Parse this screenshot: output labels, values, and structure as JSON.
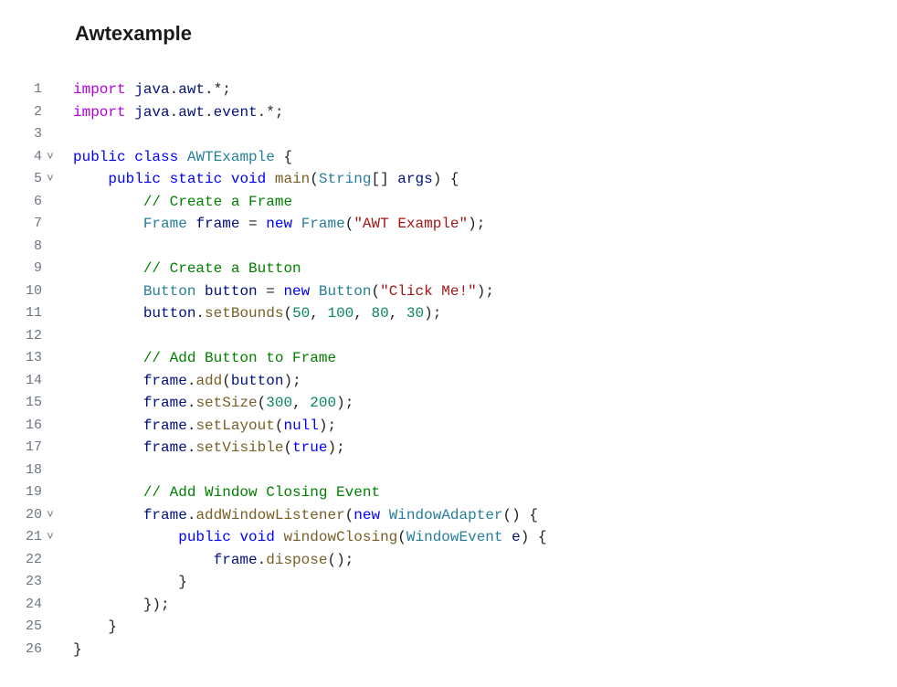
{
  "header": {
    "title": "Awtexample"
  },
  "gutter": {
    "chevron": "˅"
  },
  "lines": [
    {
      "n": 1,
      "fold": "",
      "segs": [
        [
          "kw2",
          "import"
        ],
        [
          "punc",
          " "
        ],
        [
          "id",
          "java"
        ],
        [
          "punc",
          "."
        ],
        [
          "id",
          "awt"
        ],
        [
          "punc",
          ".*;"
        ]
      ]
    },
    {
      "n": 2,
      "fold": "",
      "segs": [
        [
          "kw2",
          "import"
        ],
        [
          "punc",
          " "
        ],
        [
          "id",
          "java"
        ],
        [
          "punc",
          "."
        ],
        [
          "id",
          "awt"
        ],
        [
          "punc",
          "."
        ],
        [
          "id",
          "event"
        ],
        [
          "punc",
          ".*;"
        ]
      ]
    },
    {
      "n": 3,
      "fold": "",
      "segs": []
    },
    {
      "n": 4,
      "fold": "v",
      "segs": [
        [
          "kw",
          "public"
        ],
        [
          "punc",
          " "
        ],
        [
          "kw",
          "class"
        ],
        [
          "punc",
          " "
        ],
        [
          "cls",
          "AWTExample"
        ],
        [
          "punc",
          " {"
        ]
      ]
    },
    {
      "n": 5,
      "fold": "v",
      "segs": [
        [
          "punc",
          "    "
        ],
        [
          "kw",
          "public"
        ],
        [
          "punc",
          " "
        ],
        [
          "kw",
          "static"
        ],
        [
          "punc",
          " "
        ],
        [
          "kw",
          "void"
        ],
        [
          "punc",
          " "
        ],
        [
          "fn",
          "main"
        ],
        [
          "punc",
          "("
        ],
        [
          "cls",
          "String"
        ],
        [
          "punc",
          "[] "
        ],
        [
          "id",
          "args"
        ],
        [
          "punc",
          ") {"
        ]
      ]
    },
    {
      "n": 6,
      "fold": "",
      "segs": [
        [
          "punc",
          "        "
        ],
        [
          "cmt",
          "// Create a Frame"
        ]
      ]
    },
    {
      "n": 7,
      "fold": "",
      "segs": [
        [
          "punc",
          "        "
        ],
        [
          "cls",
          "Frame"
        ],
        [
          "punc",
          " "
        ],
        [
          "id",
          "frame"
        ],
        [
          "punc",
          " = "
        ],
        [
          "kw",
          "new"
        ],
        [
          "punc",
          " "
        ],
        [
          "cls",
          "Frame"
        ],
        [
          "punc",
          "("
        ],
        [
          "str",
          "\"AWT Example\""
        ],
        [
          "punc",
          ");"
        ]
      ]
    },
    {
      "n": 8,
      "fold": "",
      "segs": []
    },
    {
      "n": 9,
      "fold": "",
      "segs": [
        [
          "punc",
          "        "
        ],
        [
          "cmt",
          "// Create a Button"
        ]
      ]
    },
    {
      "n": 10,
      "fold": "",
      "segs": [
        [
          "punc",
          "        "
        ],
        [
          "cls",
          "Button"
        ],
        [
          "punc",
          " "
        ],
        [
          "id",
          "button"
        ],
        [
          "punc",
          " = "
        ],
        [
          "kw",
          "new"
        ],
        [
          "punc",
          " "
        ],
        [
          "cls",
          "Button"
        ],
        [
          "punc",
          "("
        ],
        [
          "str",
          "\"Click Me!\""
        ],
        [
          "punc",
          ");"
        ]
      ]
    },
    {
      "n": 11,
      "fold": "",
      "segs": [
        [
          "punc",
          "        "
        ],
        [
          "id",
          "button"
        ],
        [
          "punc",
          "."
        ],
        [
          "fn",
          "setBounds"
        ],
        [
          "punc",
          "("
        ],
        [
          "num",
          "50"
        ],
        [
          "punc",
          ", "
        ],
        [
          "num",
          "100"
        ],
        [
          "punc",
          ", "
        ],
        [
          "num",
          "80"
        ],
        [
          "punc",
          ", "
        ],
        [
          "num",
          "30"
        ],
        [
          "punc",
          ");"
        ]
      ]
    },
    {
      "n": 12,
      "fold": "",
      "segs": []
    },
    {
      "n": 13,
      "fold": "",
      "segs": [
        [
          "punc",
          "        "
        ],
        [
          "cmt",
          "// Add Button to Frame"
        ]
      ]
    },
    {
      "n": 14,
      "fold": "",
      "segs": [
        [
          "punc",
          "        "
        ],
        [
          "id",
          "frame"
        ],
        [
          "punc",
          "."
        ],
        [
          "fn",
          "add"
        ],
        [
          "punc",
          "("
        ],
        [
          "id",
          "button"
        ],
        [
          "punc",
          ");"
        ]
      ]
    },
    {
      "n": 15,
      "fold": "",
      "segs": [
        [
          "punc",
          "        "
        ],
        [
          "id",
          "frame"
        ],
        [
          "punc",
          "."
        ],
        [
          "fn",
          "setSize"
        ],
        [
          "punc",
          "("
        ],
        [
          "num",
          "300"
        ],
        [
          "punc",
          ", "
        ],
        [
          "num",
          "200"
        ],
        [
          "punc",
          ");"
        ]
      ]
    },
    {
      "n": 16,
      "fold": "",
      "segs": [
        [
          "punc",
          "        "
        ],
        [
          "id",
          "frame"
        ],
        [
          "punc",
          "."
        ],
        [
          "fn",
          "setLayout"
        ],
        [
          "punc",
          "("
        ],
        [
          "kw",
          "null"
        ],
        [
          "punc",
          ");"
        ]
      ]
    },
    {
      "n": 17,
      "fold": "",
      "segs": [
        [
          "punc",
          "        "
        ],
        [
          "id",
          "frame"
        ],
        [
          "punc",
          "."
        ],
        [
          "fn",
          "setVisible"
        ],
        [
          "punc",
          "("
        ],
        [
          "kw",
          "true"
        ],
        [
          "punc",
          ");"
        ]
      ]
    },
    {
      "n": 18,
      "fold": "",
      "segs": []
    },
    {
      "n": 19,
      "fold": "",
      "segs": [
        [
          "punc",
          "        "
        ],
        [
          "cmt",
          "// Add Window Closing Event"
        ]
      ]
    },
    {
      "n": 20,
      "fold": "v",
      "segs": [
        [
          "punc",
          "        "
        ],
        [
          "id",
          "frame"
        ],
        [
          "punc",
          "."
        ],
        [
          "fn",
          "addWindowListener"
        ],
        [
          "punc",
          "("
        ],
        [
          "kw",
          "new"
        ],
        [
          "punc",
          " "
        ],
        [
          "cls",
          "WindowAdapter"
        ],
        [
          "punc",
          "() {"
        ]
      ]
    },
    {
      "n": 21,
      "fold": "v",
      "segs": [
        [
          "punc",
          "            "
        ],
        [
          "kw",
          "public"
        ],
        [
          "punc",
          " "
        ],
        [
          "kw",
          "void"
        ],
        [
          "punc",
          " "
        ],
        [
          "fn",
          "windowClosing"
        ],
        [
          "punc",
          "("
        ],
        [
          "cls",
          "WindowEvent"
        ],
        [
          "punc",
          " "
        ],
        [
          "id",
          "e"
        ],
        [
          "punc",
          ") {"
        ]
      ]
    },
    {
      "n": 22,
      "fold": "",
      "segs": [
        [
          "punc",
          "                "
        ],
        [
          "id",
          "frame"
        ],
        [
          "punc",
          "."
        ],
        [
          "fn",
          "dispose"
        ],
        [
          "punc",
          "();"
        ]
      ]
    },
    {
      "n": 23,
      "fold": "",
      "segs": [
        [
          "punc",
          "            }"
        ]
      ]
    },
    {
      "n": 24,
      "fold": "",
      "segs": [
        [
          "punc",
          "        });"
        ]
      ]
    },
    {
      "n": 25,
      "fold": "",
      "segs": [
        [
          "punc",
          "    }"
        ]
      ]
    },
    {
      "n": 26,
      "fold": "",
      "segs": [
        [
          "punc",
          "}"
        ]
      ]
    }
  ]
}
